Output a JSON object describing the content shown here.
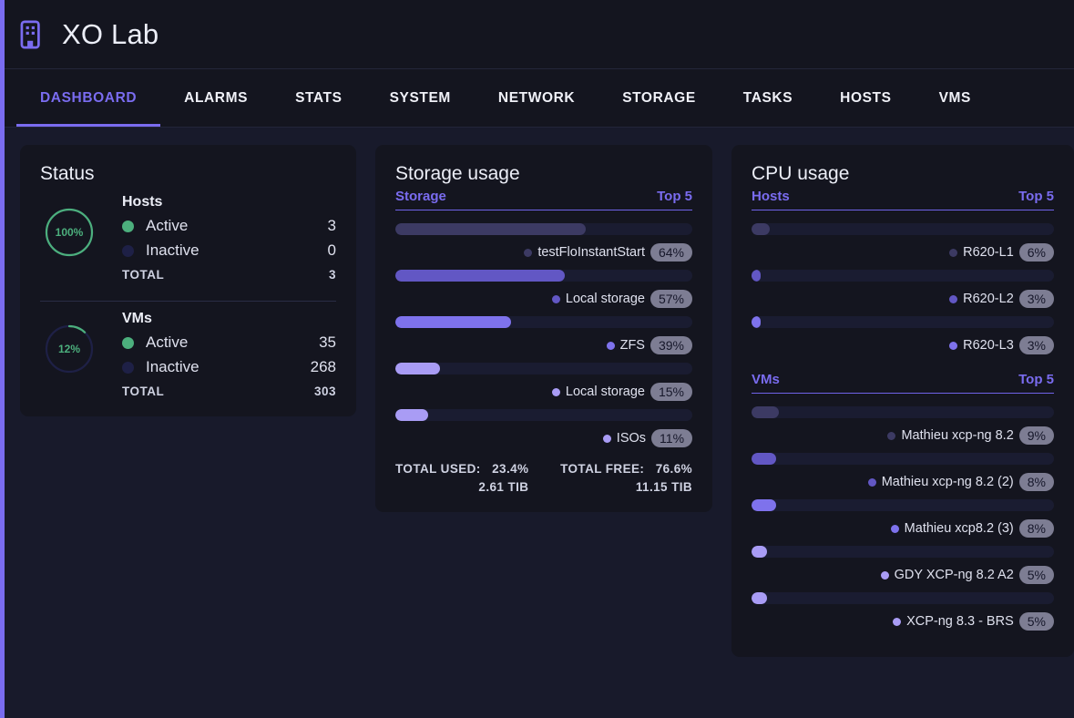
{
  "header": {
    "title": "XO Lab",
    "logo_icon": "building-icon"
  },
  "nav": {
    "tabs": [
      {
        "label": "DASHBOARD",
        "active": true
      },
      {
        "label": "ALARMS",
        "active": false
      },
      {
        "label": "STATS",
        "active": false
      },
      {
        "label": "SYSTEM",
        "active": false
      },
      {
        "label": "NETWORK",
        "active": false
      },
      {
        "label": "STORAGE",
        "active": false
      },
      {
        "label": "TASKS",
        "active": false
      },
      {
        "label": "HOSTS",
        "active": false
      },
      {
        "label": "VMS",
        "active": false
      }
    ]
  },
  "status_card": {
    "title": "Status",
    "groups": [
      {
        "name": "Hosts",
        "percent": "100%",
        "percent_value": 100,
        "active_label": "Active",
        "active_value": "3",
        "inactive_label": "Inactive",
        "inactive_value": "0",
        "total_label": "TOTAL",
        "total_value": "3"
      },
      {
        "name": "VMs",
        "percent": "12%",
        "percent_value": 12,
        "active_label": "Active",
        "active_value": "35",
        "inactive_label": "Inactive",
        "inactive_value": "268",
        "total_label": "TOTAL",
        "total_value": "303"
      }
    ]
  },
  "storage_card": {
    "title": "Storage usage",
    "section_label": "Storage",
    "section_right": "Top 5",
    "items": [
      {
        "label": "testFloInstantStart",
        "percent": "64%",
        "value": 64,
        "color": "#3c3a63"
      },
      {
        "label": "Local storage",
        "percent": "57%",
        "value": 57,
        "color": "#6257c4"
      },
      {
        "label": "ZFS",
        "percent": "39%",
        "value": 39,
        "color": "#7e72ec"
      },
      {
        "label": "Local storage",
        "percent": "15%",
        "value": 15,
        "color": "#a99cf5"
      },
      {
        "label": "ISOs",
        "percent": "11%",
        "value": 11,
        "color": "#a99cf5"
      }
    ],
    "total_used_label": "TOTAL USED:",
    "total_used_percent": "23.4%",
    "total_used_size": "2.61 TIB",
    "total_free_label": "TOTAL FREE:",
    "total_free_percent": "76.6%",
    "total_free_size": "11.15 TIB"
  },
  "cpu_card": {
    "title": "CPU usage",
    "hosts_section": {
      "label": "Hosts",
      "right": "Top 5",
      "items": [
        {
          "label": "R620-L1",
          "percent": "6%",
          "value": 6,
          "color": "#3c3a63"
        },
        {
          "label": "R620-L2",
          "percent": "3%",
          "value": 3,
          "color": "#6257c4"
        },
        {
          "label": "R620-L3",
          "percent": "3%",
          "value": 3,
          "color": "#7e72ec"
        }
      ]
    },
    "vms_section": {
      "label": "VMs",
      "right": "Top 5",
      "items": [
        {
          "label": "Mathieu xcp-ng 8.2",
          "percent": "9%",
          "value": 9,
          "color": "#3c3a63"
        },
        {
          "label": "Mathieu xcp-ng 8.2 (2)",
          "percent": "8%",
          "value": 8,
          "color": "#6257c4"
        },
        {
          "label": "Mathieu xcp8.2 (3)",
          "percent": "8%",
          "value": 8,
          "color": "#7e72ec"
        },
        {
          "label": "GDY XCP-ng 8.2 A2",
          "percent": "5%",
          "value": 5,
          "color": "#a99cf5"
        },
        {
          "label": "XCP-ng 8.3 - BRS",
          "percent": "5%",
          "value": 5,
          "color": "#a99cf5"
        }
      ]
    }
  },
  "colors": {
    "accent": "#7a6cf0",
    "page_bg": "#181a2b",
    "card_bg": "#14151f",
    "green": "#4caf7d",
    "inactive_dot": "#1e2046",
    "badge_bg": "#7d7d93"
  }
}
